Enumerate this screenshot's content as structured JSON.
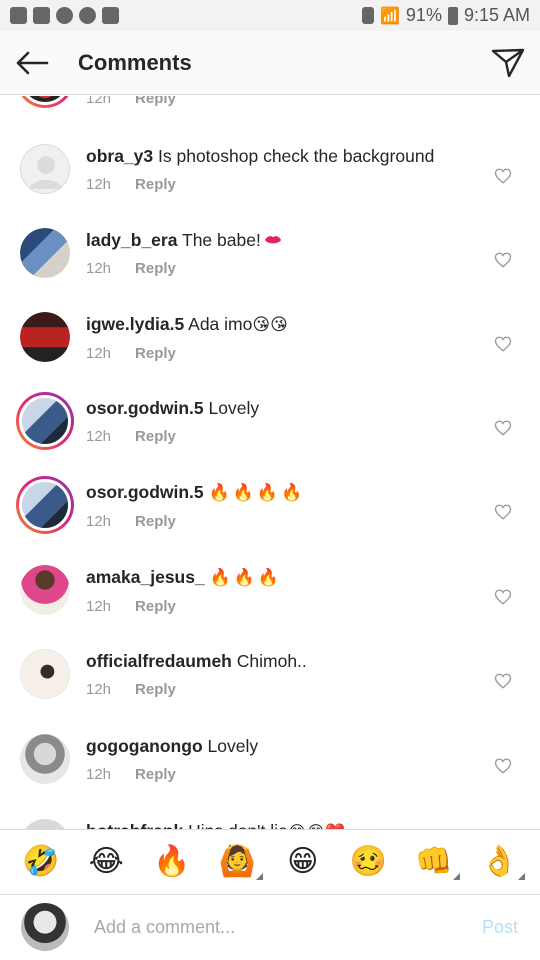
{
  "status_bar": {
    "battery": "91%",
    "time": "9:15 AM"
  },
  "header": {
    "title": "Comments"
  },
  "comments": [
    {
      "username": "",
      "text": "",
      "time": "12h",
      "reply": "Reply",
      "partial": "top"
    },
    {
      "username": "obra_y3",
      "text": "Is photoshop check the background",
      "time": "12h",
      "reply": "Reply"
    },
    {
      "username": "lady_b_era",
      "text": "The babe!",
      "emoji": [
        "lips"
      ],
      "time": "12h",
      "reply": "Reply"
    },
    {
      "username": "igwe.lydia.5",
      "text": "Ada imo",
      "emoji": [
        "kiss-face",
        "kiss-face"
      ],
      "time": "12h",
      "reply": "Reply"
    },
    {
      "username": "osor.godwin.5",
      "text": "Lovely",
      "time": "12h",
      "reply": "Reply"
    },
    {
      "username": "osor.godwin.5",
      "text": "",
      "emoji": [
        "fire",
        "fire",
        "fire",
        "fire"
      ],
      "time": "12h",
      "reply": "Reply"
    },
    {
      "username": "amaka_jesus_",
      "text": "",
      "emoji": [
        "fire",
        "fire",
        "fire"
      ],
      "time": "12h",
      "reply": "Reply"
    },
    {
      "username": "officialfredaumeh",
      "text": "Chimoh..",
      "time": "12h",
      "reply": "Reply"
    },
    {
      "username": "gogoganongo",
      "text": "Lovely",
      "time": "12h",
      "reply": "Reply"
    },
    {
      "username": "hotrebfrank",
      "text": "Hips don't lie",
      "time": "",
      "reply": "",
      "partial": "bottom"
    }
  ],
  "emoji_bar": [
    "🤣",
    "😂",
    "🔥",
    "🙆",
    "😁",
    "🥴",
    "👊",
    "👌"
  ],
  "input": {
    "placeholder": "Add a comment...",
    "post_label": "Post"
  },
  "colors": {
    "text": "#262626",
    "meta": "#999999",
    "post_disabled": "#b2dffc",
    "divider": "#dbdbdb"
  }
}
